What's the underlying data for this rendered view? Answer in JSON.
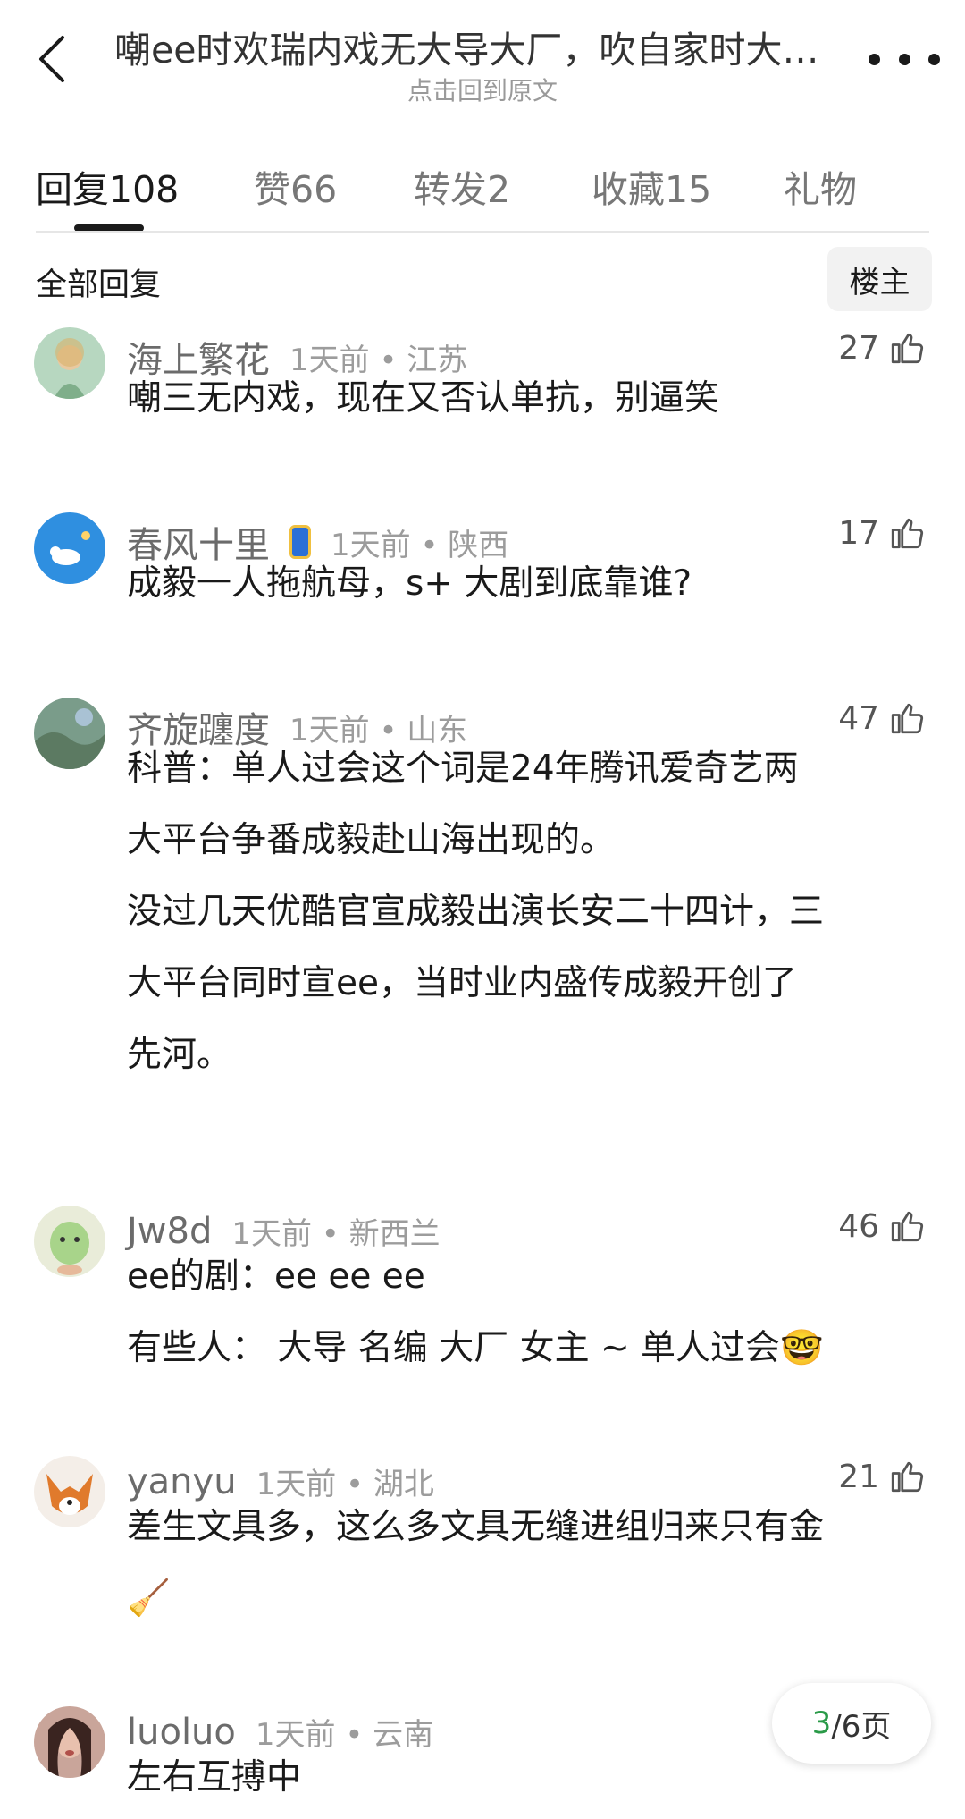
{
  "header": {
    "title": "嘲ee时欢瑞内戏无大导大厂，吹自家时大…",
    "subtitle": "点击回到原文"
  },
  "tabs": [
    {
      "label": "回复",
      "count": "108"
    },
    {
      "label": "赞",
      "count": "66"
    },
    {
      "label": "转发",
      "count": "2"
    },
    {
      "label": "收藏",
      "count": "15"
    },
    {
      "label": "礼物",
      "count": ""
    }
  ],
  "section": {
    "title": "全部回复",
    "owner_label": "楼主"
  },
  "comments": [
    {
      "name": "海上繁花",
      "time": "1天前 • 江苏",
      "likes": "27",
      "lines": [
        "嘲三无内戏，现在又否认单抗，别逼笑"
      ]
    },
    {
      "name": "春风十里",
      "time": "1天前 • 陕西",
      "likes": "17",
      "lines": [
        "成毅一人拖航母，s+ 大剧到底靠谁?"
      ]
    },
    {
      "name": "齐旋躔度",
      "time": "1天前 • 山东",
      "likes": "47",
      "lines": [
        "科普：单人过会这个词是24年腾讯爱奇艺两",
        "大平台争番成毅赴山海出现的。",
        "没过几天优酷官宣成毅出演长安二十四计，三",
        "大平台同时宣ee，当时业内盛传成毅开创了",
        "先河。"
      ]
    },
    {
      "name": "Jw8d",
      "time": "1天前 • 新西兰",
      "likes": "46",
      "lines": [
        "ee的剧：ee ee ee",
        "有些人： 大导 名编 大厂 女主 ~ 单人过会🤓"
      ]
    },
    {
      "name": "yanyu",
      "time": "1天前 • 湖北",
      "likes": "21",
      "lines": [
        "差生文具多，这么多文具无缝进组归来只有金",
        "🧹"
      ]
    },
    {
      "name": "luoluo",
      "time": "1天前 • 云南",
      "likes": "",
      "lines": [
        "左右互搏中"
      ]
    }
  ],
  "pager": {
    "current": "3",
    "total": "/6页"
  }
}
